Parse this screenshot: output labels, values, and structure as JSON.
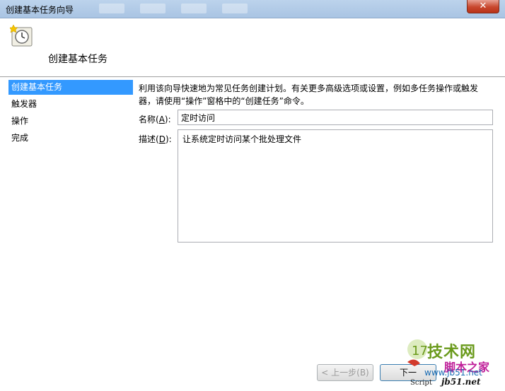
{
  "window": {
    "title": "创建基本任务向导",
    "close_label": "✕"
  },
  "header": {
    "title": "创建基本任务",
    "icon": "task-scheduler-clock-icon"
  },
  "sidebar": {
    "items": [
      {
        "label": "创建基本任务",
        "selected": true
      },
      {
        "label": "触发器",
        "selected": false
      },
      {
        "label": "操作",
        "selected": false
      },
      {
        "label": "完成",
        "selected": false
      }
    ]
  },
  "main": {
    "description_line1": "利用该向导快速地为常见任务创建计划。有关更多高级选项或设置，例如多任务操作或触发",
    "description_line2": "器，请使用“操作”窗格中的“创建任务”命令。",
    "name_label": "名称",
    "name_accel": "(A):",
    "name_accel_key": "A",
    "name_value": "定时访问",
    "desc_label": "描述",
    "desc_accel_key": "D",
    "desc_value": "让系统定时访问某个批处理文件"
  },
  "buttons": {
    "back_label": "< 上一步(B)",
    "next_label": "下一"
  },
  "watermark": {
    "top": "技术网",
    "middle": "脚本之家",
    "url": "www.jb51.net",
    "script": "Script",
    "domain": "jb51.net"
  },
  "colors": {
    "selected_bg": "#3399ff",
    "titlebar": "#b7cfea",
    "close_button": "#c8472d"
  }
}
